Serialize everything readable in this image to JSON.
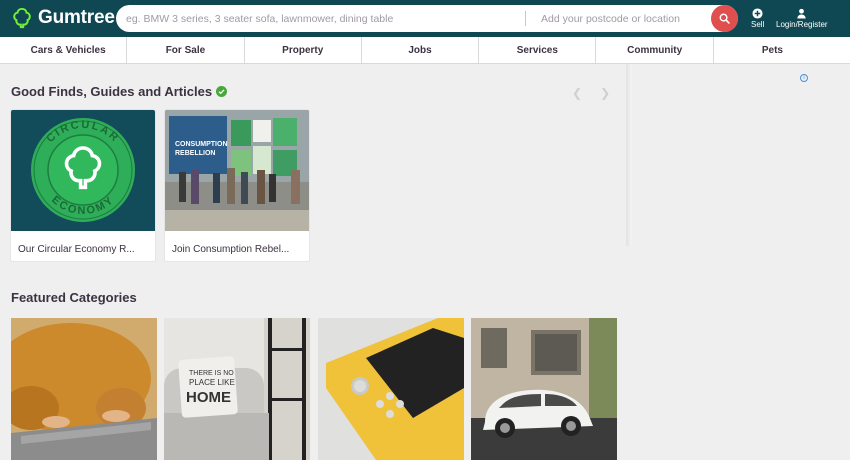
{
  "header": {
    "brand": "Gumtree",
    "search_placeholder": "eg. BMW 3 series, 3 seater sofa, lawnmower, dining table",
    "location_placeholder": "Add your postcode or location",
    "sell_label": "Sell",
    "login_label": "Login/Register"
  },
  "nav": {
    "items": [
      "Cars & Vehicles",
      "For Sale",
      "Property",
      "Jobs",
      "Services",
      "Community",
      "Pets"
    ]
  },
  "finds": {
    "title": "Good Finds, Guides and Articles",
    "cards": [
      {
        "caption": "Our Circular Economy R..."
      },
      {
        "caption": "Join Consumption Rebel..."
      }
    ]
  },
  "featured": {
    "title": "Featured Categories"
  },
  "ad_badge": "i",
  "colors": {
    "header_bg": "#0f4852",
    "brand_green": "#72ef36",
    "search_button": "#e04e4e"
  }
}
